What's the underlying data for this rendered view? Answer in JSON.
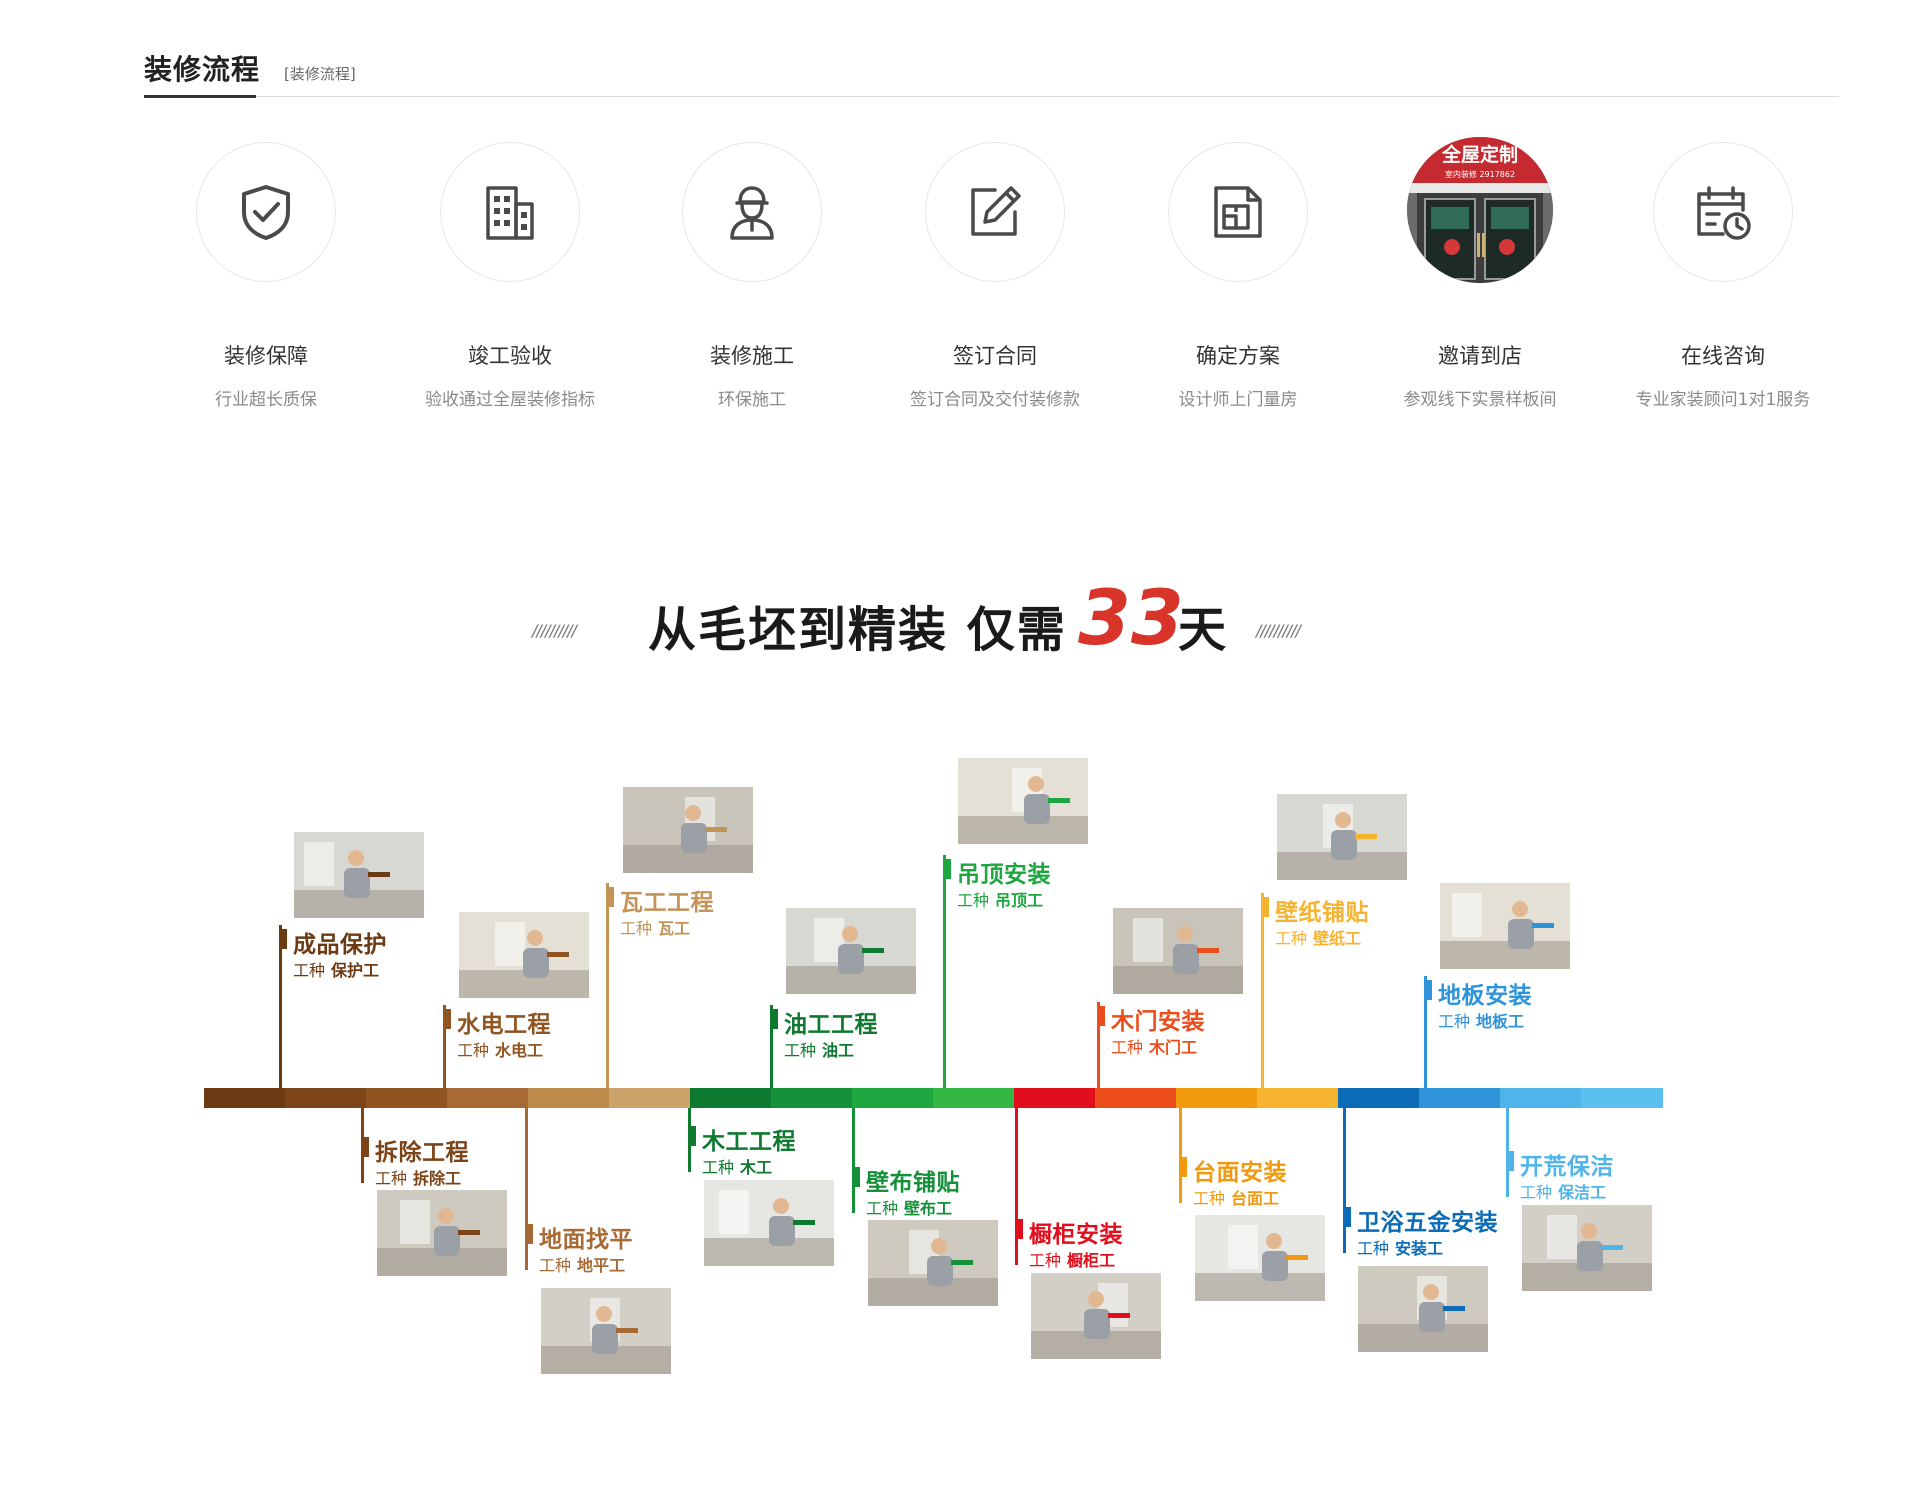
{
  "section": {
    "title": "装修流程",
    "subtitle": "[装修流程]"
  },
  "steps": [
    {
      "title": "装修保障",
      "desc": "行业超长质保",
      "icon": "shield-check-icon"
    },
    {
      "title": "竣工验收",
      "desc": "验收通过全屋装修指标",
      "icon": "building-icon"
    },
    {
      "title": "装修施工",
      "desc": "环保施工",
      "icon": "worker-icon"
    },
    {
      "title": "签订合同",
      "desc": "签订合同及交付装修款",
      "icon": "edit-icon"
    },
    {
      "title": "确定方案",
      "desc": "设计师上门量房",
      "icon": "floorplan-icon"
    },
    {
      "title": "邀请到店",
      "desc": "参观线下实景样板间",
      "icon": "store-photo",
      "active": true,
      "sign_text": "全屋定制",
      "sign_sub": "室内装修 2917862"
    },
    {
      "title": "在线咨询",
      "desc": "专业家装顾问1对1服务",
      "icon": "calendar-clock-icon"
    }
  ],
  "slogan": {
    "main": "从毛坯到精装 仅需",
    "number": "33",
    "suffix": "天",
    "decoration": "//////////"
  },
  "timeline": {
    "worker_prefix": "工种",
    "colors": [
      "#6b3a12",
      "#7d4417",
      "#8f5420",
      "#a86a34",
      "#bd8a4c",
      "#cca36a",
      "#0d7a2f",
      "#15913a",
      "#1ea640",
      "#35b843",
      "#e10f1d",
      "#ec4d1a",
      "#f19a10",
      "#f6b330",
      "#0b6bb6",
      "#2e93d8",
      "#4fb4ea",
      "#5bbfef"
    ],
    "stages": [
      {
        "name": "成品保护",
        "worker": "保护工",
        "color": "#6b3a12"
      },
      {
        "name": "拆除工程",
        "worker": "拆除工",
        "color": "#7d4417"
      },
      {
        "name": "水电工程",
        "worker": "水电工",
        "color": "#8f5420"
      },
      {
        "name": "地面找平",
        "worker": "地平工",
        "color": "#a86a34"
      },
      {
        "name": "瓦工工程",
        "worker": "瓦工",
        "color": "#c39455"
      },
      {
        "name": "木工工程",
        "worker": "木工",
        "color": "#0d7a2f"
      },
      {
        "name": "油工工程",
        "worker": "油工",
        "color": "#0d7a2f"
      },
      {
        "name": "壁布铺贴",
        "worker": "壁布工",
        "color": "#15913a"
      },
      {
        "name": "吊顶安装",
        "worker": "吊顶工",
        "color": "#1ea640"
      },
      {
        "name": "橱柜安装",
        "worker": "橱柜工",
        "color": "#e10f1d"
      },
      {
        "name": "木门安装",
        "worker": "木门工",
        "color": "#ec4d1a"
      },
      {
        "name": "台面安装",
        "worker": "台面工",
        "color": "#f19a10"
      },
      {
        "name": "壁纸铺贴",
        "worker": "壁纸工",
        "color": "#f6b330"
      },
      {
        "name": "卫浴五金安装",
        "worker": "安装工",
        "color": "#0b6bb6"
      },
      {
        "name": "地板安装",
        "worker": "地板工",
        "color": "#2e93d8"
      },
      {
        "name": "开荒保洁",
        "worker": "保洁工",
        "color": "#4fb4ea"
      }
    ]
  }
}
